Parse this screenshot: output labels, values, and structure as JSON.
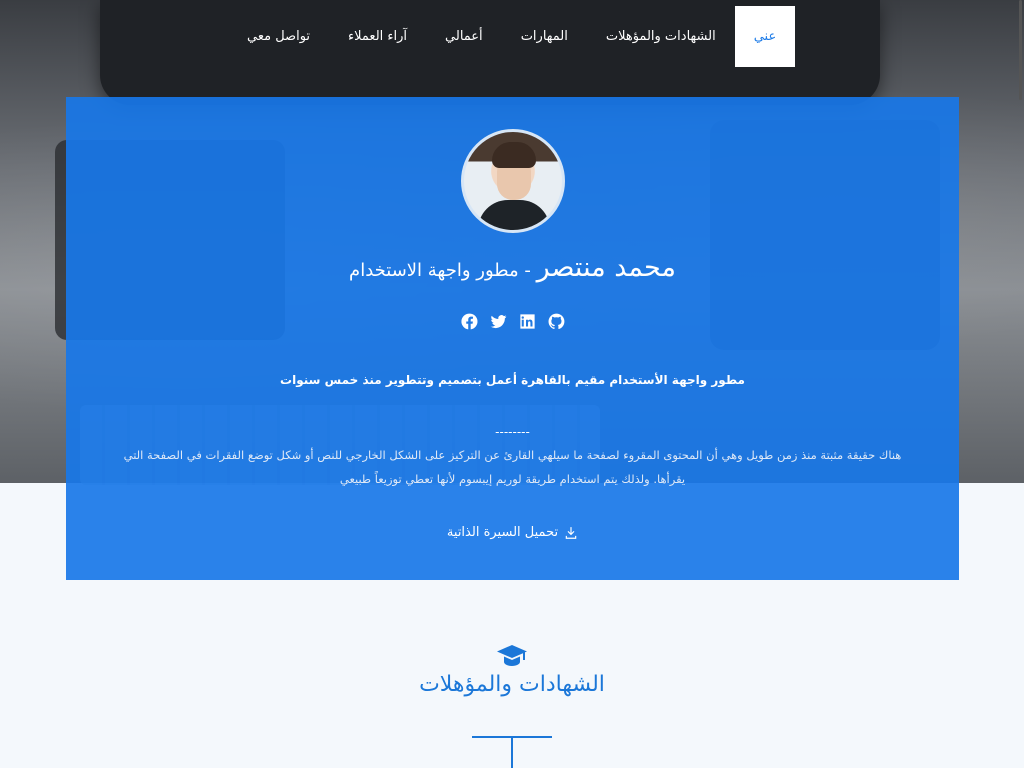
{
  "nav": {
    "items": [
      {
        "label": "عني",
        "active": true
      },
      {
        "label": "الشهادات والمؤهلات",
        "active": false
      },
      {
        "label": "المهارات",
        "active": false
      },
      {
        "label": "أعمالي",
        "active": false
      },
      {
        "label": "آراء العملاء",
        "active": false
      },
      {
        "label": "تواصل معي",
        "active": false
      }
    ]
  },
  "hero": {
    "name": "محمد منتصر",
    "separator": " - ",
    "role": "مطور واجهة الاستخدام",
    "social_icons": [
      "facebook-icon",
      "twitter-icon",
      "linkedin-icon",
      "github-icon"
    ],
    "tagline": "مطور واجهة الأستخدام مقيم بالقاهرة أعمل بتصميم وتتطوير منذ خمس سنوات",
    "dashes": "--------",
    "bio": "هناك حقيقة مثبتة منذ زمن طويل وهي أن المحتوى المقروء لصفحة ما سيلهي القارئ عن التركيز على الشكل الخارجي للنص أو شكل توضع الفقرات في الصفحة التي يقرأها. ولذلك يتم استخدام طريقة لوريم إيبسوم لأنها تعطي توزيعاً طبيعي",
    "cv_button": "تحميل السيرة الذاتية"
  },
  "certificates": {
    "icon": "graduation-cap-icon",
    "title": "الشهادات والمؤهلات"
  },
  "colors": {
    "accent": "#1e7ce8",
    "section_title": "#1b77d8",
    "page_bg": "#f4f8fc"
  }
}
